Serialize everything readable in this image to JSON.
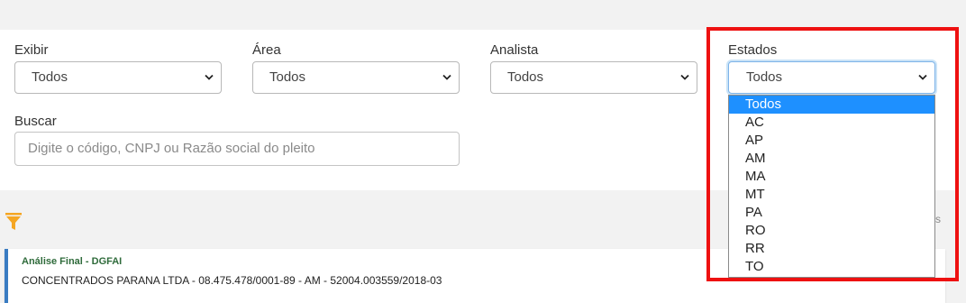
{
  "filters": {
    "exibir": {
      "label": "Exibir",
      "value": "Todos"
    },
    "area": {
      "label": "Área",
      "value": "Todos"
    },
    "analista": {
      "label": "Analista",
      "value": "Todos"
    },
    "estados": {
      "label": "Estados",
      "value": "Todos",
      "options": [
        "Todos",
        "AC",
        "AP",
        "AM",
        "MA",
        "MT",
        "PA",
        "RO",
        "RR",
        "TO"
      ],
      "selected_index": 0
    },
    "buscar": {
      "label": "Buscar",
      "placeholder": "Digite o código, CNPJ ou Razão social do pleito",
      "value": ""
    }
  },
  "results": {
    "side_text": "s",
    "card": {
      "title": "Análise Final - DGFAI",
      "subtitle": "CONCENTRADOS PARANA LTDA - 08.475.478/0001-89 - AM - 52004.003559/2018-03"
    }
  },
  "colors": {
    "highlight": "#ee1111",
    "selected_option": "#1e90ff",
    "filter_icon": "#f5a623",
    "card_title": "#2f6b3b"
  },
  "icons": {
    "filter": "funnel-icon",
    "chevron": "chevron-down-icon"
  }
}
